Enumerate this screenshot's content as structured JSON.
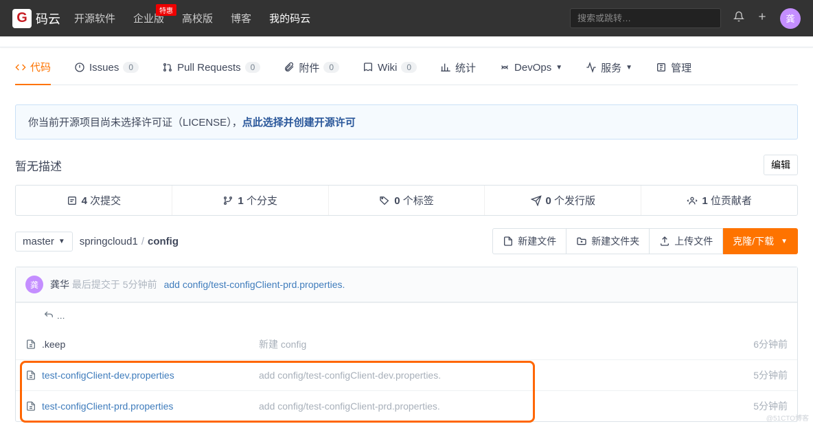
{
  "topbar": {
    "logo_text": "码云",
    "nav": [
      "开源软件",
      "企业版",
      "高校版",
      "博客",
      "我的码云"
    ],
    "badge": "特惠",
    "search_placeholder": "搜索或跳转…",
    "avatar_initial": "龚"
  },
  "tabs": {
    "code": "代码",
    "issues": "Issues",
    "issues_count": "0",
    "pr": "Pull Requests",
    "pr_count": "0",
    "attach": "附件",
    "attach_count": "0",
    "wiki": "Wiki",
    "wiki_count": "0",
    "stats": "统计",
    "devops": "DevOps",
    "services": "服务",
    "manage": "管理"
  },
  "notice": {
    "pre": "你当前开源项目尚未选择许可证（LICENSE），",
    "link": "点此选择并创建开源许可"
  },
  "desc": {
    "text": "暂无描述",
    "edit": "编辑"
  },
  "stats": {
    "commits_n": "4",
    "commits": "次提交",
    "branches_n": "1",
    "branches": "个分支",
    "tags_n": "0",
    "tags": "个标签",
    "releases_n": "0",
    "releases": "个发行版",
    "contrib_n": "1",
    "contrib": "位贡献者"
  },
  "actions": {
    "branch": "master",
    "repo": "springcloud1",
    "path": "config",
    "new_file": "新建文件",
    "new_folder": "新建文件夹",
    "upload": "上传文件",
    "clone": "克隆/下载"
  },
  "commit": {
    "avatar_initial": "龚",
    "author": "龚华",
    "meta_pre": "最后提交于",
    "when": "5分钟前",
    "msg": "add config/test-configClient-prd.properties."
  },
  "updots": "...",
  "files": [
    {
      "name": ".keep",
      "msg": "新建 config",
      "time": "6分钟前",
      "link": false
    },
    {
      "name": "test-configClient-dev.properties",
      "msg": "add config/test-configClient-dev.properties.",
      "time": "5分钟前",
      "link": true
    },
    {
      "name": "test-configClient-prd.properties",
      "msg": "add config/test-configClient-prd.properties.",
      "time": "5分钟前",
      "link": true
    }
  ],
  "watermark": "@51CTO博客"
}
